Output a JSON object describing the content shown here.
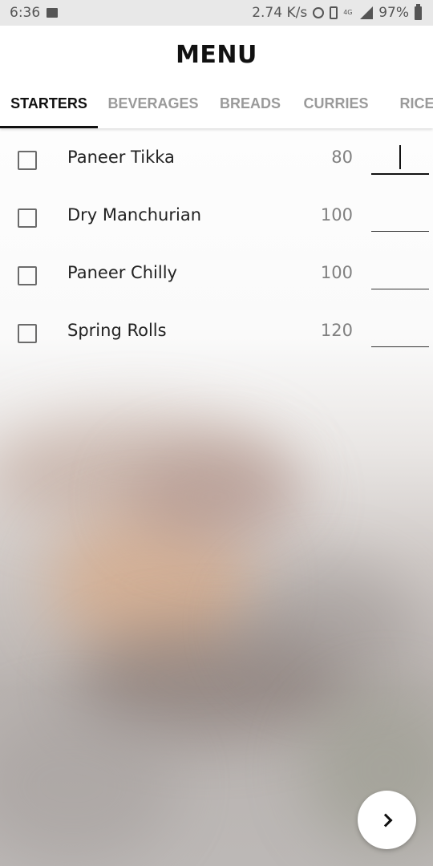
{
  "status_bar": {
    "time": "6:36",
    "net_speed": "2.74 K/s",
    "network_type": "4G",
    "battery": "97%",
    "icons": [
      "image-icon",
      "alarm-icon",
      "vibrate-icon",
      "signal-icon",
      "battery-icon"
    ]
  },
  "app_bar": {
    "title": "MENU"
  },
  "tabs": [
    {
      "label": "STARTERS",
      "active": true
    },
    {
      "label": "BEVERAGES",
      "active": false
    },
    {
      "label": "BREADS",
      "active": false
    },
    {
      "label": "CURRIES",
      "active": false
    },
    {
      "label": "RICE",
      "active": false
    }
  ],
  "items": [
    {
      "name": "Paneer Tikka",
      "price": "80",
      "checked": false,
      "quantity": "",
      "focused": true
    },
    {
      "name": "Dry Manchurian",
      "price": "100",
      "checked": false,
      "quantity": "",
      "focused": false
    },
    {
      "name": "Paneer Chilly",
      "price": "100",
      "checked": false,
      "quantity": "",
      "focused": false
    },
    {
      "name": "Spring Rolls",
      "price": "120",
      "checked": false,
      "quantity": "",
      "focused": false
    }
  ],
  "fab": {
    "icon": "chevron-right-icon"
  },
  "colors": {
    "accent": "#111111",
    "tab_inactive": "#9a9a9a",
    "price": "#808080"
  }
}
